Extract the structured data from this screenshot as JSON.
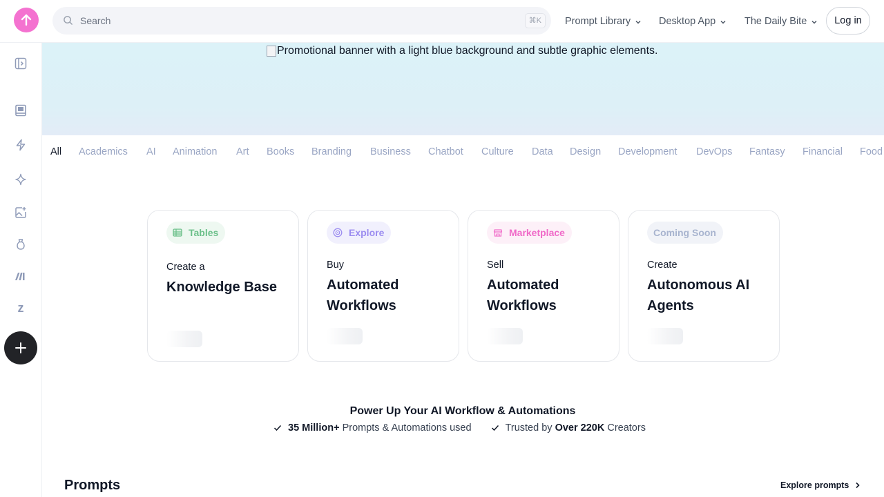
{
  "header": {
    "search_placeholder": "Search",
    "search_shortcut": "⌘K",
    "nav": [
      {
        "label": "Prompt Library"
      },
      {
        "label": "Desktop App"
      },
      {
        "label": "The Daily Bite"
      }
    ],
    "login_label": "Log in"
  },
  "sidebar": {
    "icons": [
      "sidebar-toggle-icon",
      "book-icon",
      "lightning-icon",
      "sparkle-icon",
      "image-plus-icon",
      "bag-icon",
      "make-logo-icon",
      "zapier-logo-icon"
    ],
    "zapier_glyph": "z"
  },
  "banner": {
    "alt_text": "Promotional banner with a light blue background and subtle graphic elements."
  },
  "categories": [
    "All",
    "Academics",
    "AI",
    "Animation",
    "Art",
    "Books",
    "Branding",
    "Business",
    "Chatbot",
    "Culture",
    "Data",
    "Design",
    "Development",
    "DevOps",
    "Fantasy",
    "Financial",
    "Food"
  ],
  "active_category": "All",
  "cards": [
    {
      "badge": "Tables",
      "badge_color": "#6cc08a",
      "badge_bg": "#eef8f1",
      "small": "Create a",
      "title": "Knowledge Base"
    },
    {
      "badge": "Explore",
      "badge_color": "#9b8cf0",
      "badge_bg": "#f1f0fd",
      "small": "Buy",
      "title": "Automated Workflows"
    },
    {
      "badge": "Marketplace",
      "badge_color": "#f06ac8",
      "badge_bg": "#fdf0f8",
      "small": "Sell",
      "title": "Automated Workflows"
    },
    {
      "badge": "Coming Soon",
      "badge_color": "#a8b4cf",
      "badge_bg": "#f1f3f8",
      "small": "Create",
      "title": "Autonomous AI Agents"
    }
  ],
  "power": {
    "title": "Power Up Your AI Workflow & Automations",
    "stat1_bold": "35 Million+",
    "stat1_rest": " Prompts & Automations used",
    "stat2_pre": "Trusted by ",
    "stat2_bold": "Over 220K",
    "stat2_rest": " Creators"
  },
  "prompts_section": {
    "title": "Prompts",
    "explore_label": "Explore prompts"
  }
}
